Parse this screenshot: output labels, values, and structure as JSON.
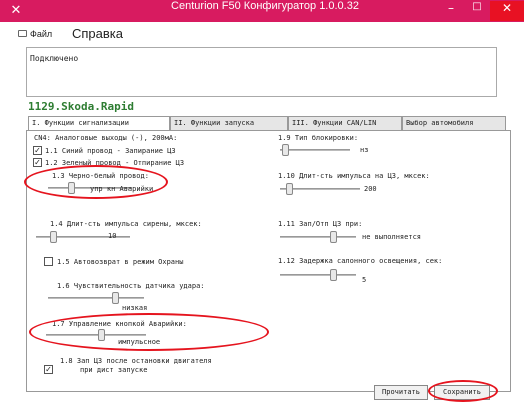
{
  "window": {
    "title": "Centurion F50 Конфигуратор 1.0.0.32",
    "min_glyph": "–",
    "max_glyph": "□",
    "close_glyph": "✕",
    "app_icon": "x-logo-icon"
  },
  "menu": {
    "file": "Файл",
    "help": "Справка"
  },
  "log": {
    "text": "Подключено"
  },
  "config_name": "1129.Skoda.Rapid",
  "tabs": [
    {
      "label": "I. Функции сигнализации"
    },
    {
      "label": "II. Функции запуска"
    },
    {
      "label": "III. Функции CAN/LIN"
    },
    {
      "label": "Выбор автомобиля"
    }
  ],
  "left": {
    "group_title": "CN4: Аналоговые выходы (-), 200мА:",
    "item_1_1": "1.1 Синий провод - Запирание ЦЗ",
    "item_1_1_checked": true,
    "item_1_2": "1.2 Зеленый провод - Отпирание ЦЗ",
    "item_1_2_checked": true,
    "item_1_3": "1.3 Черно-белый провод:",
    "item_1_3_value": "упр кн Аварийки",
    "item_1_4": "1.4 Длит-сть импульса сирены, мксек:",
    "item_1_4_value": "10",
    "item_1_5": "1.5 Автовозврат в режим Охраны",
    "item_1_5_checked": false,
    "item_1_6": "1.6 Чувствительность датчика удара:",
    "item_1_6_value": "низкая",
    "item_1_7": "1.7 Управление кнопкой Аварийки:",
    "item_1_7_value": "импульсное",
    "item_1_8": "1.8 Зап ЦЗ после остановки двигателя",
    "item_1_8_line2": "при дист запуске",
    "item_1_8_checked": true
  },
  "right": {
    "item_1_9": "1.9  Тип блокировки:",
    "item_1_9_value": "нз",
    "item_1_10": "1.10 Длит-сть импульса на ЦЗ, мксек:",
    "item_1_10_value": "200",
    "item_1_11": "1.11 Зап/Отп ЦЗ при:",
    "item_1_11_value": "не выполняется",
    "item_1_12": "1.12 Задержка салонного освещения, сек:",
    "item_1_12_value": "5"
  },
  "buttons": {
    "read": "Прочитать",
    "save": "Сохранить"
  },
  "colors": {
    "titlebar": "#d81b60",
    "close": "#e81123",
    "highlight": "#e5141e",
    "config_name": "#2e7d32"
  }
}
